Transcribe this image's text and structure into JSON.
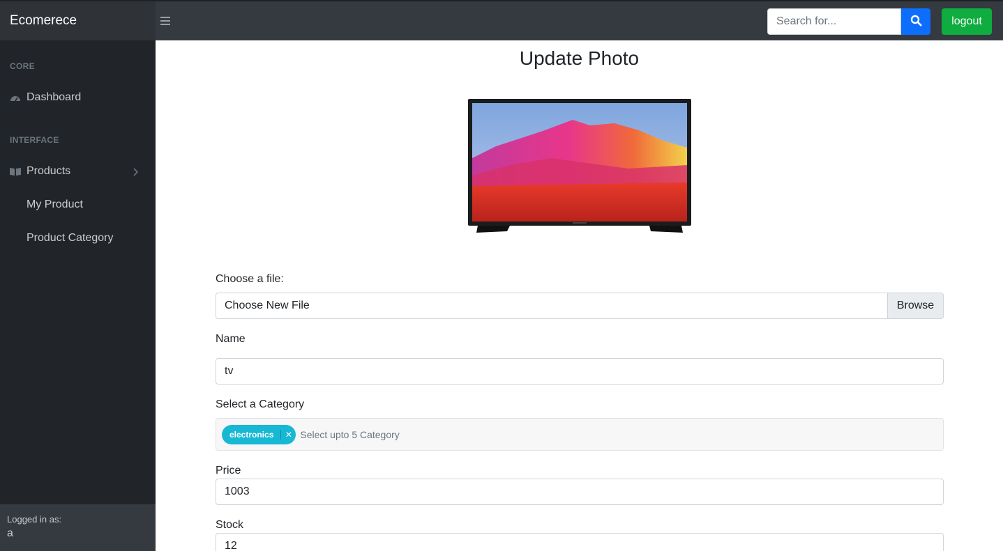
{
  "app": {
    "brand": "Ecomerece"
  },
  "topbar": {
    "search_placeholder": "Search for...",
    "logout_label": "logout"
  },
  "sidebar": {
    "heading_core": "CORE",
    "dashboard_label": "Dashboard",
    "heading_interface": "INTERFACE",
    "products_label": "Products",
    "sub_items": [
      "My Product",
      "Product Category"
    ],
    "footer_label": "Logged in as:",
    "footer_user": "a"
  },
  "main": {
    "title": "Update Photo",
    "file_label": "Choose a file:",
    "file_text": "Choose New File",
    "browse_label": "Browse",
    "name_label": "Name",
    "name_value": "tv",
    "category_label": "Select a Category",
    "category_tags": [
      "electronics"
    ],
    "category_placeholder": "Select upto 5 Category",
    "price_label": "Price",
    "price_value": "1003",
    "stock_label": "Stock",
    "stock_value": "12"
  },
  "colors": {
    "navbar": "#343a40",
    "sidebar": "#212529",
    "search_button": "#0d6efd",
    "logout_button": "#0fad3f",
    "tag": "#17b8d4"
  }
}
